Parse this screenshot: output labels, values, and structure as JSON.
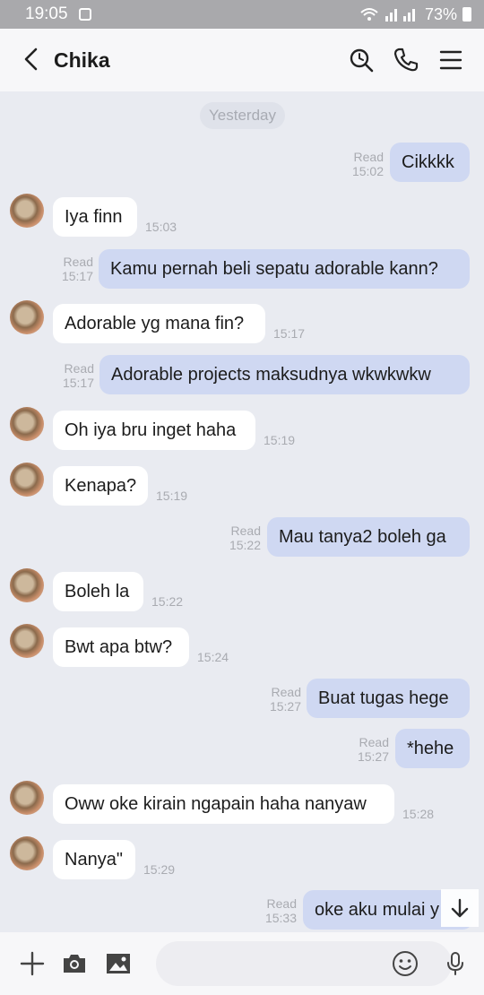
{
  "status_bar": {
    "time": "19:05",
    "battery": "73%"
  },
  "header": {
    "title": "Chika"
  },
  "date_chip": "Yesterday",
  "messages": [
    {
      "dir": "out",
      "text": "Cikkkk",
      "read": "Read",
      "time": "15:02"
    },
    {
      "dir": "in",
      "text": "Iya finn",
      "time": "15:03"
    },
    {
      "dir": "out",
      "text": "Kamu pernah beli sepatu adorable kann?",
      "read": "Read",
      "time": "15:17"
    },
    {
      "dir": "in",
      "text": "Adorable yg mana fin?",
      "time": "15:17"
    },
    {
      "dir": "out",
      "text": "Adorable projects maksudnya wkwkwkw",
      "read": "Read",
      "time": "15:17"
    },
    {
      "dir": "in",
      "text": "Oh iya bru inget haha",
      "time": "15:19"
    },
    {
      "dir": "in",
      "text": "Kenapa?",
      "time": "15:19"
    },
    {
      "dir": "out",
      "text": "Mau tanya2 boleh ga",
      "read": "Read",
      "time": "15:22"
    },
    {
      "dir": "in",
      "text": "Boleh la",
      "time": "15:22"
    },
    {
      "dir": "in",
      "text": "Bwt apa btw?",
      "time": "15:24"
    },
    {
      "dir": "out",
      "text": "Buat tugas hege",
      "read": "Read",
      "time": "15:27"
    },
    {
      "dir": "out",
      "text": "*hehe",
      "read": "Read",
      "time": "15:27"
    },
    {
      "dir": "in",
      "text": "Oww oke kirain ngapain haha nanyaw",
      "time": "15:28"
    },
    {
      "dir": "in",
      "text": "Nanya\"",
      "time": "15:29"
    },
    {
      "dir": "out",
      "text": "oke aku mulai y",
      "read": "Read",
      "time": "15:33"
    }
  ],
  "icons": {
    "back": "chevron-left-icon",
    "search": "search-icon",
    "call": "phone-icon",
    "menu": "menu-icon",
    "add": "plus-icon",
    "camera": "camera-icon",
    "gallery": "image-icon",
    "emoji": "emoji-icon",
    "mic": "microphone-icon",
    "scroll_down": "arrow-down-icon"
  },
  "colors": {
    "background": "#e9ebf1",
    "outgoing": "#cfd8f2",
    "incoming": "#ffffff",
    "meta": "#a9abb1"
  }
}
